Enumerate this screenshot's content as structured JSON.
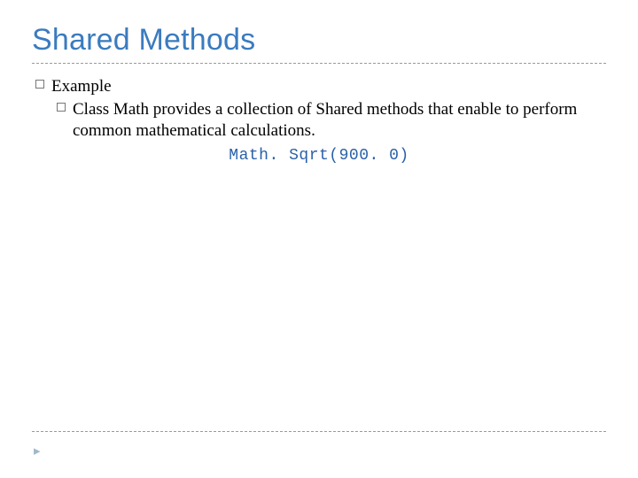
{
  "title": "Shared Methods",
  "bullets": {
    "level1_label": "Example",
    "level2_text": "Class Math provides a collection of Shared methods that enable to perform common mathematical calculations."
  },
  "code": "Math. Sqrt(900. 0)",
  "footer_marker": "▸"
}
